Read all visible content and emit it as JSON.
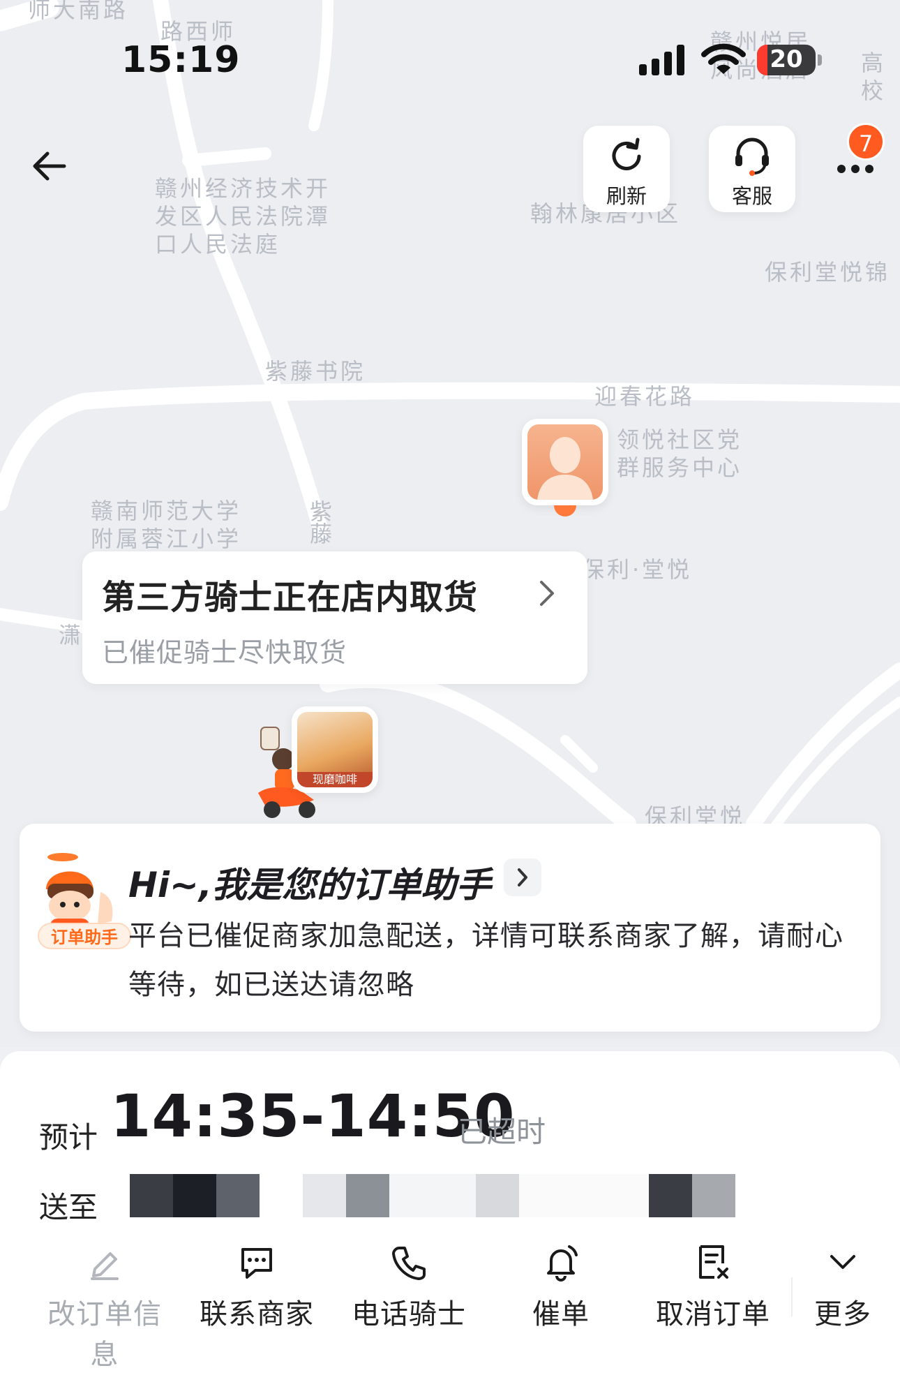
{
  "status_bar": {
    "time": "15:19",
    "battery": "20"
  },
  "nav": {
    "refresh_label": "刷新",
    "service_label": "客服",
    "notification_count": "7"
  },
  "map": {
    "labels": [
      "师大南路",
      "师\n西\n路",
      "赣州经济技术开\n发区人民法院潭\n口人民法庭",
      "赣州悦居\n风尚酒店",
      "高校",
      "翰林康居小区",
      "保利堂悦锦",
      "紫藤书院",
      "迎春花路",
      "领悦社区党\n群服务中心",
      "赣南师范大学\n附属蓉江小学",
      "紫藤",
      "保利·堂悦",
      "潇",
      "保利堂悦"
    ]
  },
  "rider_card": {
    "title": "第三方骑士正在店内取货",
    "subtitle": "已催促骑士尽快取货"
  },
  "store_marker": {
    "caption": "现磨咖啡"
  },
  "assistant": {
    "tag": "订单助手",
    "title": "Hi~,我是您的订单助手",
    "message": "平台已催促商家加急配送，详情可联系商家了解，请耐心等待，如已送达请忽略"
  },
  "delivery": {
    "eta_label": "预计",
    "eta_value": "14:35-14:50",
    "eta_status": "已超时",
    "address_label": "送至"
  },
  "actions": [
    {
      "label": "改订单信息",
      "icon": "edit-icon"
    },
    {
      "label": "联系商家",
      "icon": "chat-icon"
    },
    {
      "label": "电话骑士",
      "icon": "phone-icon"
    },
    {
      "label": "催单",
      "icon": "bell-icon"
    },
    {
      "label": "取消订单",
      "icon": "cancel-order-icon"
    },
    {
      "label": "更多",
      "icon": "chevron-down-icon"
    }
  ],
  "colors": {
    "accent": "#ff5a1f",
    "muted_text": "#9a9ea5",
    "map_bg": "#eceef1"
  }
}
